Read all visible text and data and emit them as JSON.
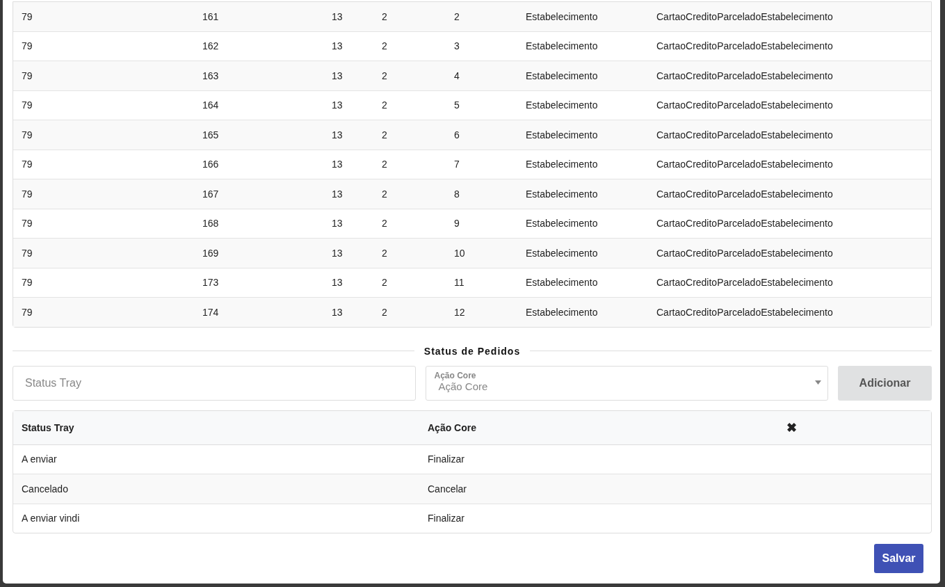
{
  "orders_table": {
    "rows": [
      [
        "79",
        "161",
        "13",
        "2",
        "2",
        "Estabelecimento",
        "CartaoCreditoParceladoEstabelecimento"
      ],
      [
        "79",
        "162",
        "13",
        "2",
        "3",
        "Estabelecimento",
        "CartaoCreditoParceladoEstabelecimento"
      ],
      [
        "79",
        "163",
        "13",
        "2",
        "4",
        "Estabelecimento",
        "CartaoCreditoParceladoEstabelecimento"
      ],
      [
        "79",
        "164",
        "13",
        "2",
        "5",
        "Estabelecimento",
        "CartaoCreditoParceladoEstabelecimento"
      ],
      [
        "79",
        "165",
        "13",
        "2",
        "6",
        "Estabelecimento",
        "CartaoCreditoParceladoEstabelecimento"
      ],
      [
        "79",
        "166",
        "13",
        "2",
        "7",
        "Estabelecimento",
        "CartaoCreditoParceladoEstabelecimento"
      ],
      [
        "79",
        "167",
        "13",
        "2",
        "8",
        "Estabelecimento",
        "CartaoCreditoParceladoEstabelecimento"
      ],
      [
        "79",
        "168",
        "13",
        "2",
        "9",
        "Estabelecimento",
        "CartaoCreditoParceladoEstabelecimento"
      ],
      [
        "79",
        "169",
        "13",
        "2",
        "10",
        "Estabelecimento",
        "CartaoCreditoParceladoEstabelecimento"
      ],
      [
        "79",
        "173",
        "13",
        "2",
        "11",
        "Estabelecimento",
        "CartaoCreditoParceladoEstabelecimento"
      ],
      [
        "79",
        "174",
        "13",
        "2",
        "12",
        "Estabelecimento",
        "CartaoCreditoParceladoEstabelecimento"
      ]
    ]
  },
  "section_title": "Status de Pedidos",
  "form": {
    "status_field": {
      "placeholder": "Status Tray"
    },
    "action_select": {
      "label": "Ação Core",
      "placeholder": "Ação Core"
    },
    "add_button": {
      "label": "Adicionar",
      "disabled": true
    }
  },
  "status_table": {
    "columns": [
      "Status Tray",
      "Ação Core",
      "✖"
    ],
    "rows": [
      [
        "A enviar",
        "Finalizar"
      ],
      [
        "Cancelado",
        "Cancelar"
      ],
      [
        "A enviar vindi",
        "Finalizar"
      ]
    ]
  },
  "save_button": "Salvar"
}
